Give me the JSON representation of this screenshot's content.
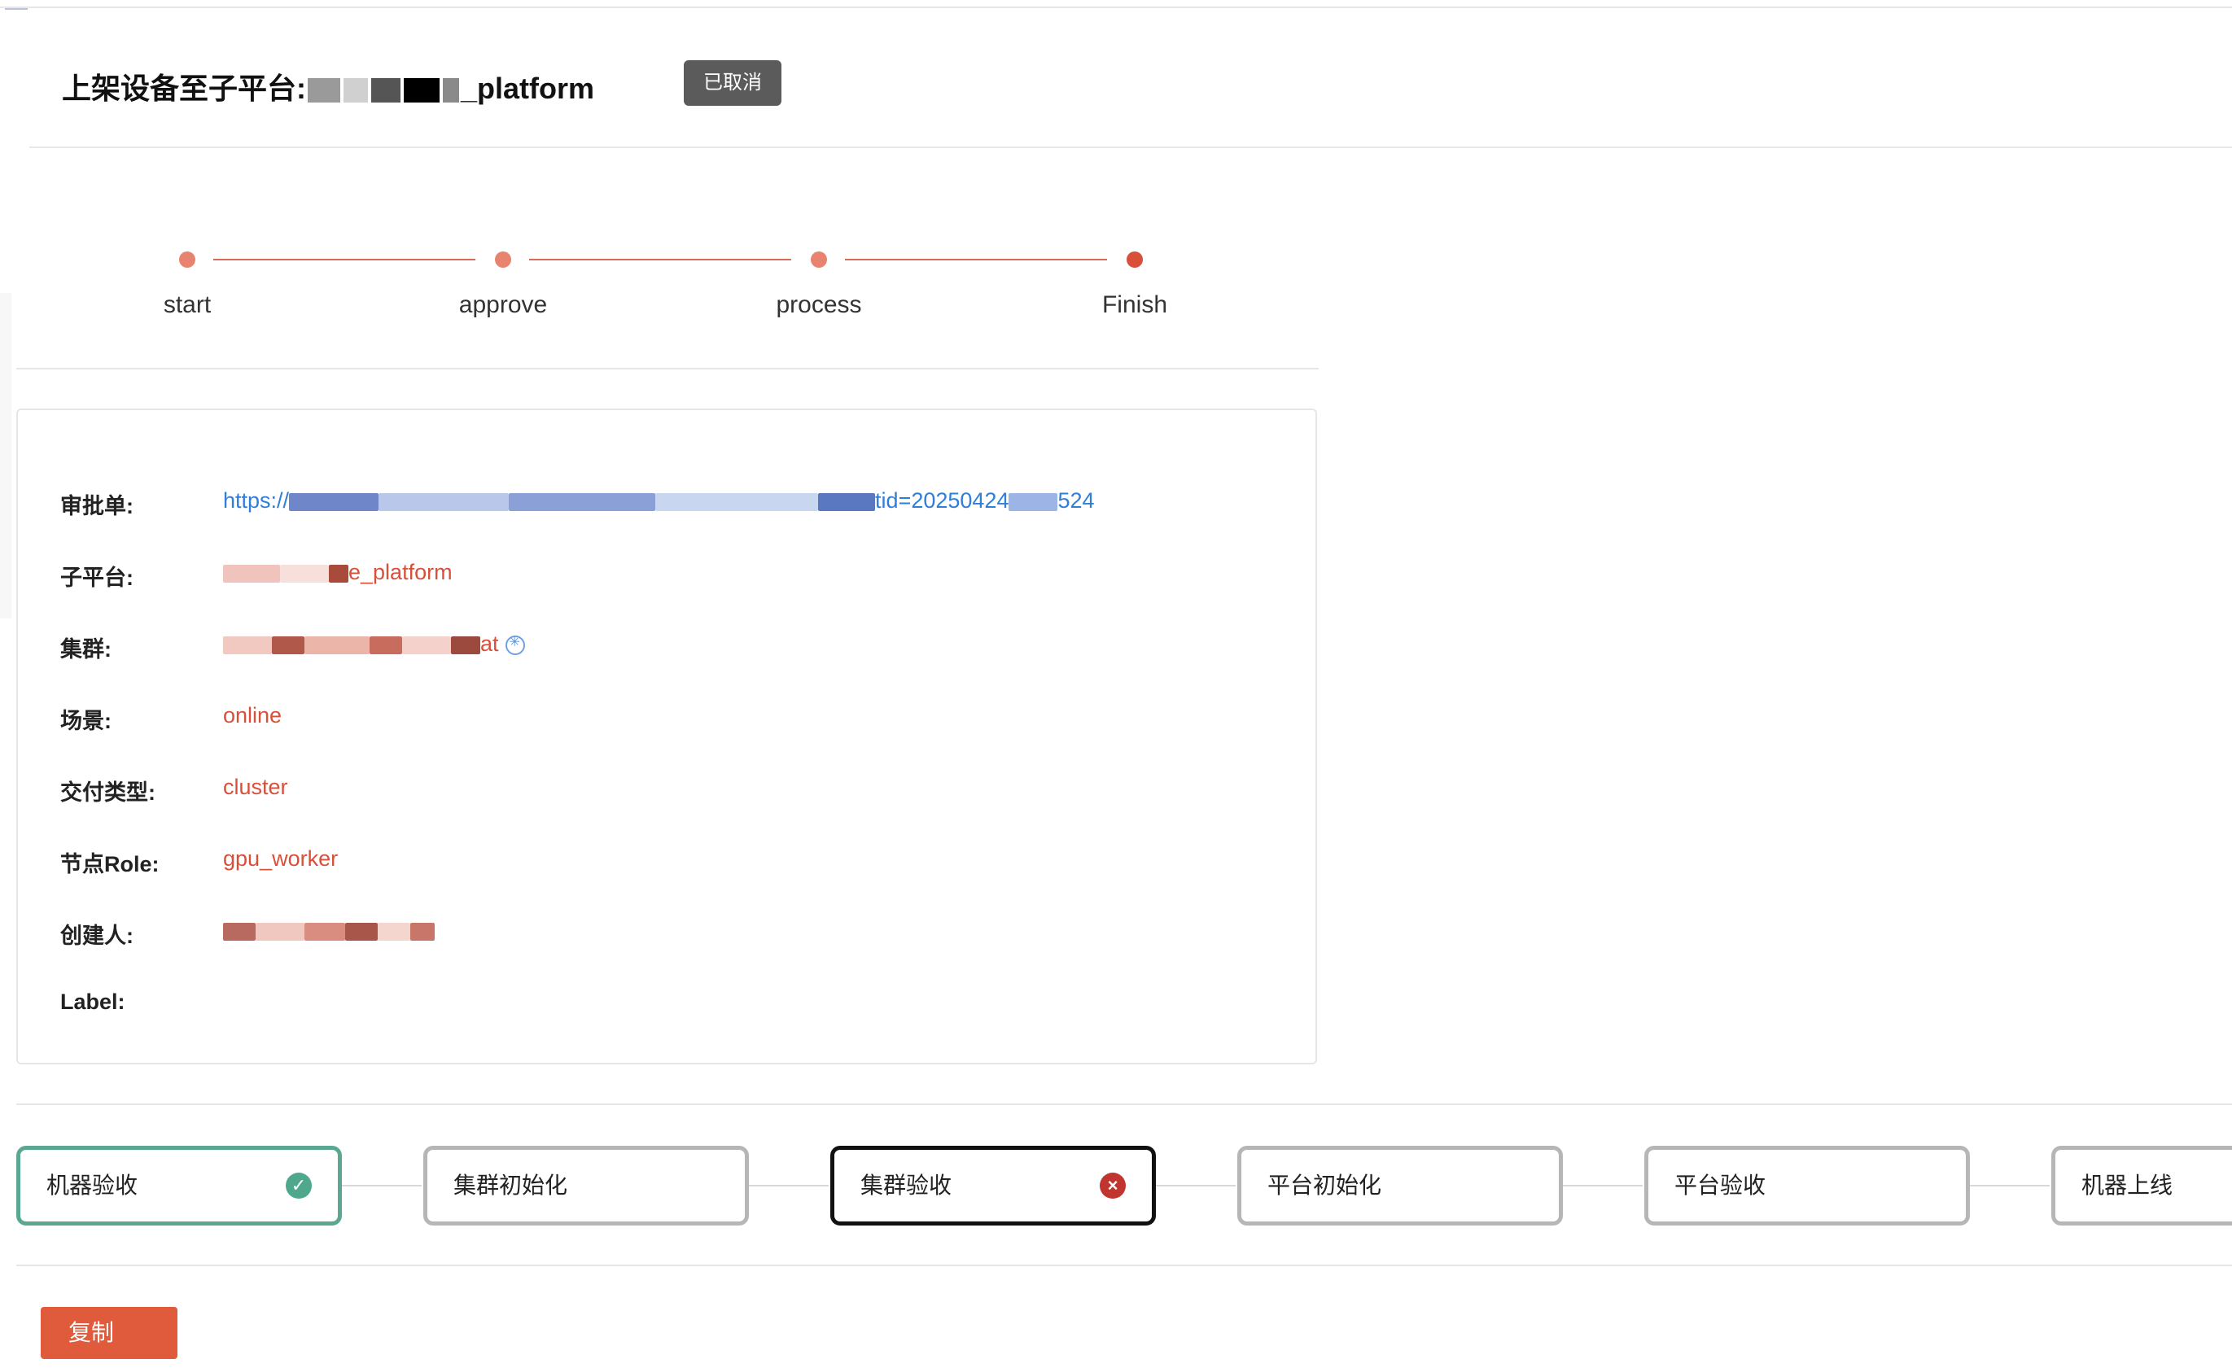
{
  "header": {
    "title_prefix": "上架设备至子平台:",
    "title_suffix": "_platform",
    "status": "已取消"
  },
  "steps": [
    {
      "label": "start",
      "state": "done"
    },
    {
      "label": "approve",
      "state": "done"
    },
    {
      "label": "process",
      "state": "done"
    },
    {
      "label": "Finish",
      "state": "current"
    }
  ],
  "info": {
    "approval_label": "审批单:",
    "approval_value_prefix": "https://",
    "approval_value_suffix": "tid=20250424",
    "approval_value_tail": "524",
    "subplatform_label": "子平台:",
    "subplatform_value_suffix": "e_platform",
    "cluster_label": "集群:",
    "cluster_value_suffix": "at",
    "scene_label": "场景:",
    "scene_value": "online",
    "delivery_label": "交付类型:",
    "delivery_value": "cluster",
    "role_label": "节点Role:",
    "role_value": "gpu_worker",
    "creator_label": "创建人:",
    "label_label": "Label:"
  },
  "flow": [
    {
      "label": "机器验收",
      "state": "done",
      "icon": "check-icon"
    },
    {
      "label": "集群初始化",
      "state": "pending"
    },
    {
      "label": "集群验收",
      "state": "error",
      "icon": "close-icon"
    },
    {
      "label": "平台初始化",
      "state": "pending"
    },
    {
      "label": "平台验收",
      "state": "pending"
    },
    {
      "label": "机器上线",
      "state": "pending"
    }
  ],
  "actions": {
    "copy_label": "复制"
  },
  "colors": {
    "accent": "#d9503a",
    "link": "#2f7fd8",
    "success": "#4fa88c",
    "error": "#c0352f"
  }
}
